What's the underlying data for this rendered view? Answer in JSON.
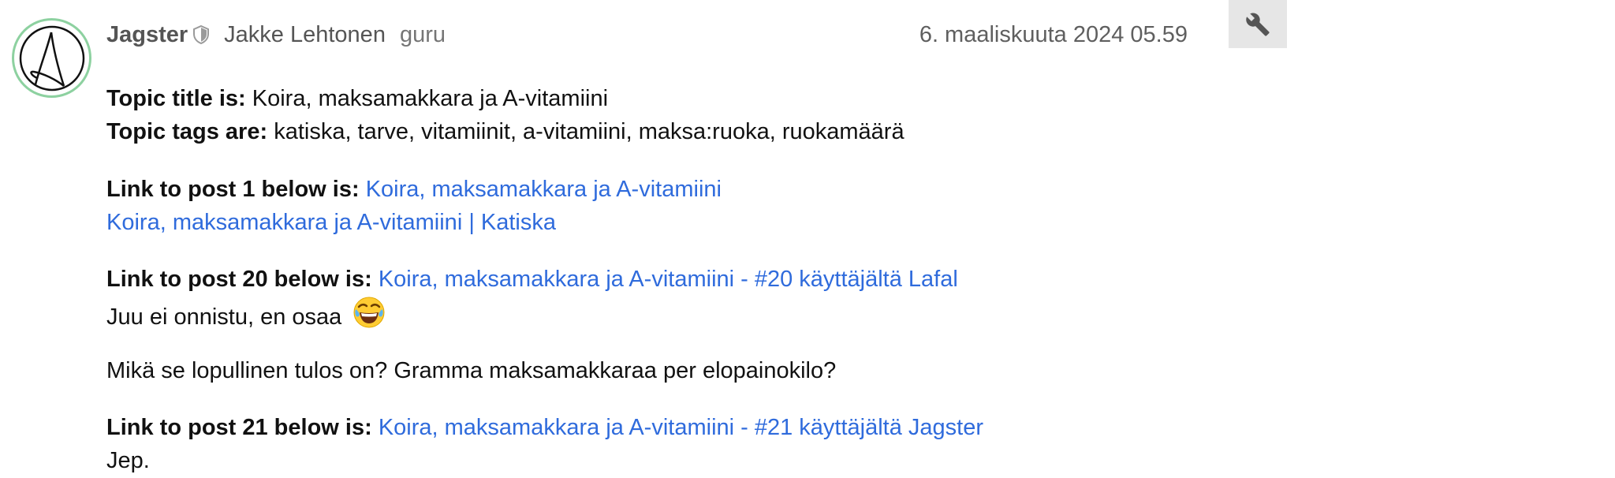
{
  "post": {
    "username": "Jagster",
    "full_name": "Jakke Lehtonen",
    "user_title": "guru",
    "date": "6. maaliskuuta 2024 05.59",
    "avatar_icon": "anarchy-a-avatar",
    "moderator_icon": "shield-icon",
    "admin_icon": "wrench-icon"
  },
  "content": {
    "topic_title_label": "Topic title is:",
    "topic_title": "Koira, maksamakkara ja A-vitamiini",
    "topic_tags_label": "Topic tags are:",
    "topic_tags": "katiska, tarve, vitamiinit, a-vitamiini, maksa:ruoka, ruokamäärä",
    "link1_label": "Link to post 1 below is:",
    "link1_text": "Koira, maksamakkara ja A-vitamiini",
    "post1_text": "Koira, maksamakkara ja A-vitamiini | Katiska",
    "link20_label": "Link to post 20 below is:",
    "link20_text": "Koira, maksamakkara ja A-vitamiini - #20 käyttäjältä Lafal",
    "post20_text": "Juu ei onnistu, en osaa",
    "post20_emoji": "joy-emoji",
    "post20_question": "Mikä se lopullinen tulos on? Gramma maksamakkaraa per elopainokilo?",
    "link21_label": "Link to post 21 below is:",
    "link21_text": "Koira, maksamakkara ja A-vitamiini - #21 käyttäjältä Jagster",
    "post21_text": "Jep."
  },
  "colors": {
    "link": "#2f6bdc",
    "avatar_ring": "#8dd1a0",
    "admin_button_bg": "#e6e6e6"
  }
}
